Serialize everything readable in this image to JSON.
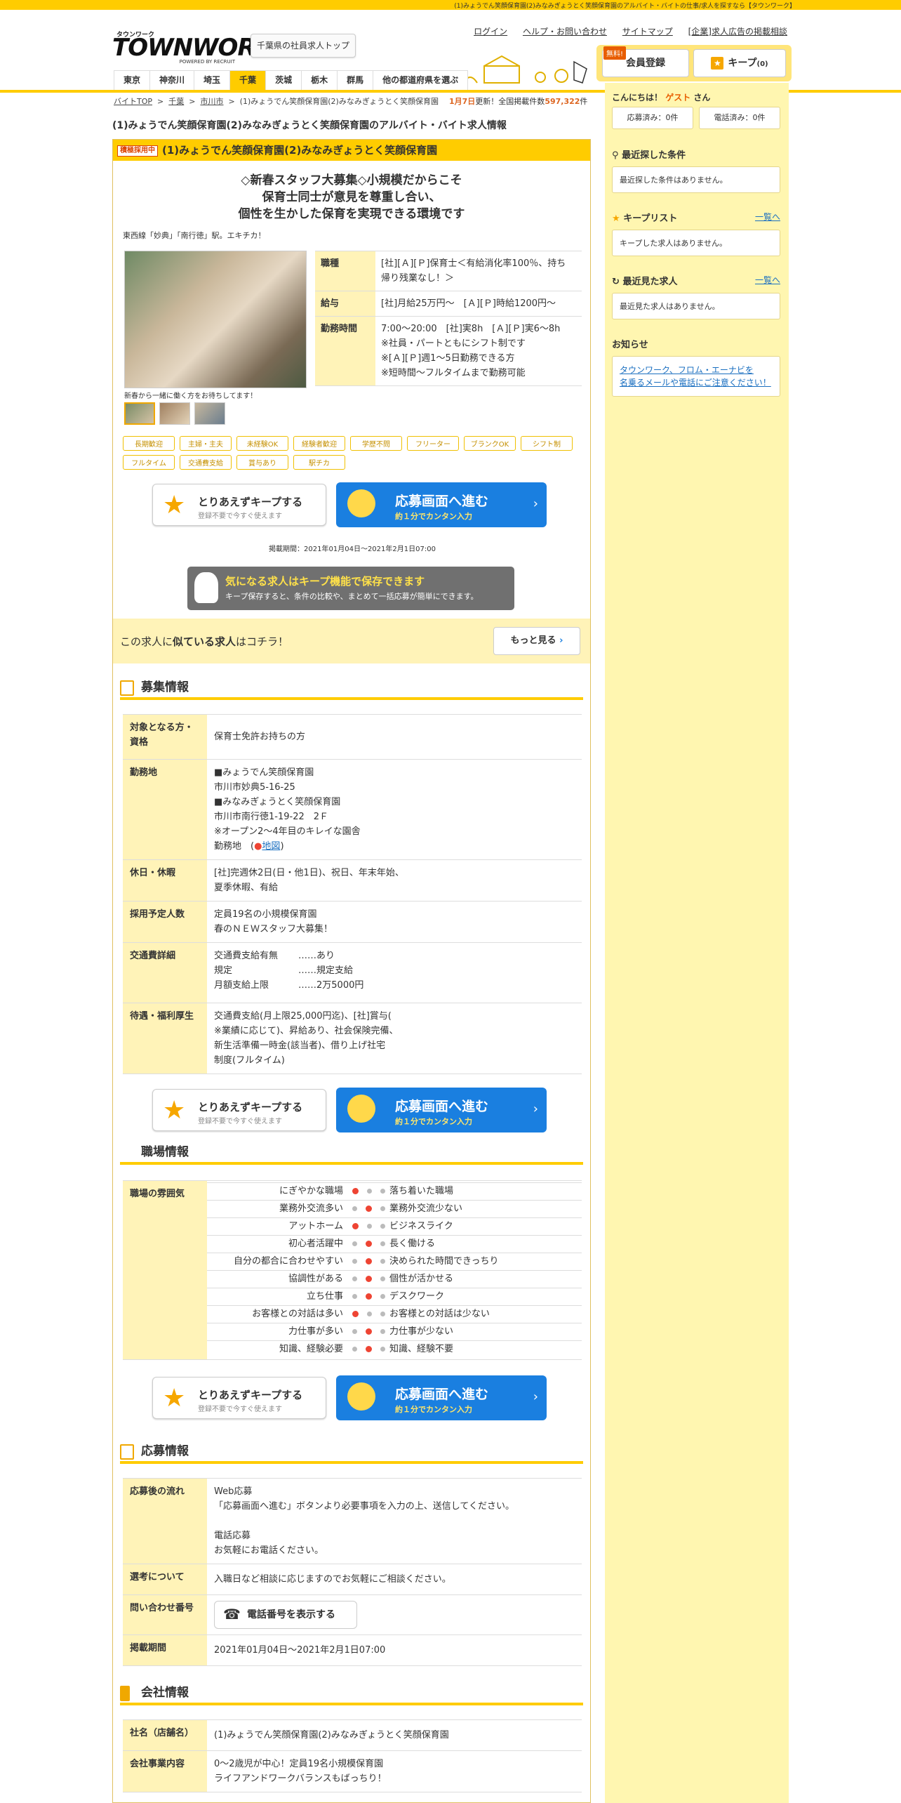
{
  "top_tagline": "(1)みょうでん笑顔保育園(2)みなみぎょうとく笑顔保育園のアルバイト・バイトの仕事/求人を探すなら【タウンワーク】",
  "logo": {
    "small": "タウンワーク",
    "big": "TOWNWORK",
    "powered": "POWERED BY RECRUIT"
  },
  "pref_top": "千葉県の社員求人トップ",
  "top_links": [
    "ログイン",
    "ヘルプ・お問い合わせ",
    "サイトマップ",
    "[企業]求人広告の掲載相談"
  ],
  "member": {
    "free": "無料!",
    "label": "会員登録"
  },
  "keep": {
    "label": "キープ",
    "count": "(0)"
  },
  "prefs": [
    "東京",
    "神奈川",
    "埼玉",
    "千葉",
    "茨城",
    "栃木",
    "群馬",
    "他の都道府県を選ぶ"
  ],
  "breadcrumb": {
    "items": [
      "バイトTOP",
      "千葉",
      "市川市"
    ],
    "current": "(1)みょうでん笑顔保育園(2)みなみぎょうとく笑顔保育園",
    "sep": ">"
  },
  "update": {
    "date": "1月7日",
    "mid": "更新！全国掲載件数",
    "count": "597,322",
    "unit": "件"
  },
  "page_title": "(1)みょうでん笑顔保育園(2)みなみぎょうとく笑顔保育園のアルバイト・バイト求人情報",
  "job": {
    "tag": "積極採用中",
    "name": "(1)みょうでん笑顔保育園(2)みなみぎょうとく笑顔保育園",
    "catch": [
      "◇新春スタッフ大募集◇小規模だからこそ",
      "保育士同士が意見を尊重し合い、",
      "個性を生かした保育を実現できる環境です"
    ],
    "station": "東西線「妙典」「南行徳」駅。エキチカ！",
    "photo_caption": "新春から一緒に働く方をお待ちしてます！",
    "spec": [
      {
        "k": "職種",
        "v": [
          "[社][Ａ][Ｐ]保育士＜有給消化率100％、持ち",
          "帰り残業なし！＞"
        ]
      },
      {
        "k": "給与",
        "v": [
          "[社]月給25万円～　[Ａ][Ｐ]時給1200円～"
        ]
      },
      {
        "k": "勤務時間",
        "v": [
          "7:00～20:00　[社]実8h　[Ａ][Ｐ]実6～8h",
          "※社員・パートともにシフト制です",
          "※[Ａ][Ｐ]週1～5日勤務できる方",
          "※短時間～フルタイムまで勤務可能"
        ]
      }
    ],
    "tags": [
      "長期歓迎",
      "主婦・主夫",
      "未経験OK",
      "経験者歓迎",
      "学歴不問",
      "フリーター",
      "ブランクOK",
      "シフト制",
      "フルタイム",
      "交通費支給",
      "賞与あり",
      "駅チカ"
    ],
    "period": "掲載期間：2021年01月04日～2021年2月1日07:00"
  },
  "buttons": {
    "keep_t1": "とりあえずキープする",
    "keep_t2": "登録不要で今すぐ使えます",
    "apply_t1": "応募画面へ進む",
    "apply_t2": "約１分でカンタン入力",
    "arrow": "›"
  },
  "keep_ad": {
    "t1": "気になる求人はキープ機能で保存できます",
    "t2": "キープ保存すると、条件の比較や、まとめて一括応募が簡単にできます。"
  },
  "similar": {
    "pre": "この求人に",
    "bold": "似ている求人",
    "post": "はコチラ！",
    "more": "もっと見る"
  },
  "recruit": {
    "title": "募集情報",
    "rows": [
      {
        "k": [
          "対象となる方・",
          "資格"
        ],
        "v": [
          "保育士免許お持ちの方"
        ]
      },
      {
        "k": [
          "勤務地"
        ],
        "v": [
          "■みょうでん笑顔保育園",
          "市川市妙典5-16-25",
          "■みなみぎょうとく笑顔保育園",
          "市川市南行徳1-19-22　2Ｆ",
          "※オープン2～4年目のキレイな園舎"
        ],
        "map_pre": "勤務地　(",
        "map_link": "地図",
        "map_post": ")"
      },
      {
        "k": [
          "休日・休暇"
        ],
        "v": [
          "[社]完週休2日(日・他1日)、祝日、年末年始、",
          "夏季休暇、有給"
        ]
      },
      {
        "k": [
          "採用予定人数"
        ],
        "v": [
          "定員19名の小規模保育園",
          "春のＮＥＷスタッフ大募集！"
        ]
      },
      {
        "k": [
          "交通費詳細"
        ],
        "fare": [
          [
            "交通費支給有無",
            "……あり"
          ],
          [
            "規定",
            "……規定支給"
          ],
          [
            "月額支給上限",
            "……2万5000円"
          ]
        ]
      },
      {
        "k": [
          "待遇・福利厚生"
        ],
        "v": [
          "交通費支給(月上限25,000円迄)、[社]賞与(",
          "※業績に応じて)、昇給あり、社会保険完備、",
          "新生活準備一時金(該当者)、借り上げ社宅",
          "制度(フルタイム)"
        ]
      }
    ]
  },
  "workplace": {
    "title": "職場情報",
    "label": "職場の雰囲気",
    "rows": [
      {
        "l": "にぎやかな職場",
        "r": "落ち着いた職場",
        "pos": 1
      },
      {
        "l": "業務外交流多い",
        "r": "業務外交流少ない",
        "pos": 2
      },
      {
        "l": "アットホーム",
        "r": "ビジネスライク",
        "pos": 1
      },
      {
        "l": "初心者活躍中",
        "r": "長く働ける",
        "pos": 2
      },
      {
        "l": "自分の都合に合わせやすい",
        "r": "決められた時間できっちり",
        "pos": 2
      },
      {
        "l": "協調性がある",
        "r": "個性が活かせる",
        "pos": 2
      },
      {
        "l": "立ち仕事",
        "r": "デスクワーク",
        "pos": 2
      },
      {
        "l": "お客様との対話は多い",
        "r": "お客様との対話は少ない",
        "pos": 1
      },
      {
        "l": "力仕事が多い",
        "r": "力仕事が少ない",
        "pos": 2
      },
      {
        "l": "知識、経験必要",
        "r": "知識、経験不要",
        "pos": 2
      }
    ]
  },
  "apply": {
    "title": "応募情報",
    "rows": [
      {
        "k": "応募後の流れ",
        "v": [
          "Web応募",
          "「応募画面へ進む」ボタンより必要事項を入力の上、送信してください。",
          "",
          "電話応募",
          "お気軽にお電話ください。"
        ]
      },
      {
        "k": "選考について",
        "v": [
          "入職日など相談に応じますのでお気軽にご相談ください。"
        ]
      },
      {
        "k": "問い合わせ番号",
        "tel": "電話番号を表示する"
      },
      {
        "k": "掲載期間",
        "v": [
          "2021年01月04日～2021年2月1日07:00"
        ]
      }
    ]
  },
  "company": {
    "title": "会社情報",
    "rows": [
      {
        "k": "社名（店舗名）",
        "v": [
          "(1)みょうでん笑顔保育園(2)みなみぎょうとく笑顔保育園"
        ]
      },
      {
        "k": "会社事業内容",
        "v": [
          "0～2歳児が中心！定員19名小規模保育園",
          "ライフアンドワークバランスもばっちり！"
        ]
      }
    ]
  },
  "sidebar": {
    "greet_pre": "こんにちは！",
    "guest": "ゲスト",
    "greet_post": "さん",
    "applied": "応募済み：0件",
    "called": "電話済み：0件",
    "recent_search": {
      "title": "最近探した条件",
      "empty": "最近探した条件はありません。"
    },
    "keep_list": {
      "title": "キープリスト",
      "link": "一覧へ",
      "empty": "キープした求人はありません。"
    },
    "recent_view": {
      "title": "最近見た求人",
      "link": "一覧へ",
      "empty": "最近見た求人はありません。"
    },
    "notice": {
      "title": "お知らせ",
      "link": [
        "タウンワーク、フロム・エーナビを",
        "名乗るメールや電話にご注意ください！"
      ]
    }
  }
}
